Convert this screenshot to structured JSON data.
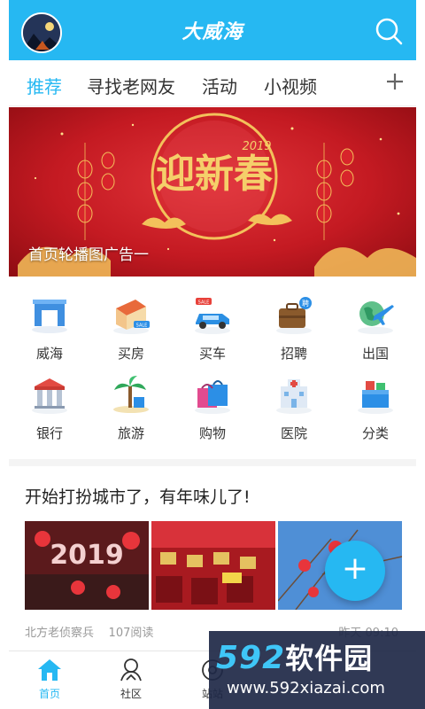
{
  "header": {
    "title": "大威海",
    "search_icon": "search-icon",
    "avatar_icon": "avatar"
  },
  "tabs": [
    {
      "label": "推荐"
    },
    {
      "label": "寻找老网友"
    },
    {
      "label": "活动"
    },
    {
      "label": "小视频"
    }
  ],
  "banner": {
    "caption": "首页轮播图广告一",
    "art_text": "迎新春",
    "year": "2019"
  },
  "categories": [
    {
      "label": "威海",
      "icon": "arch-icon"
    },
    {
      "label": "买房",
      "icon": "house-sale-icon"
    },
    {
      "label": "买车",
      "icon": "car-sale-icon"
    },
    {
      "label": "招聘",
      "icon": "briefcase-icon"
    },
    {
      "label": "出国",
      "icon": "plane-globe-icon"
    },
    {
      "label": "银行",
      "icon": "bank-icon"
    },
    {
      "label": "旅游",
      "icon": "palm-tree-icon"
    },
    {
      "label": "购物",
      "icon": "shopping-bag-icon"
    },
    {
      "label": "医院",
      "icon": "hospital-icon"
    },
    {
      "label": "分类",
      "icon": "boxes-icon"
    }
  ],
  "article": {
    "title": "开始打扮城市了，有年味儿了!",
    "author": "北方老侦察兵",
    "reads": "107阅读",
    "time": "昨天 09:10"
  },
  "fab": {
    "label": "+"
  },
  "bottom_nav": [
    {
      "label": "首页",
      "icon": "home-icon"
    },
    {
      "label": "社区",
      "icon": "community-icon"
    },
    {
      "label": "站站",
      "icon": "station-icon"
    }
  ],
  "watermark": {
    "brand_digits": "592",
    "brand_text": "软件园",
    "url": "www.592xiazai.com"
  },
  "colors": {
    "accent": "#26b8f2",
    "banner_red": "#c41a22",
    "gold": "#f3c15b"
  }
}
